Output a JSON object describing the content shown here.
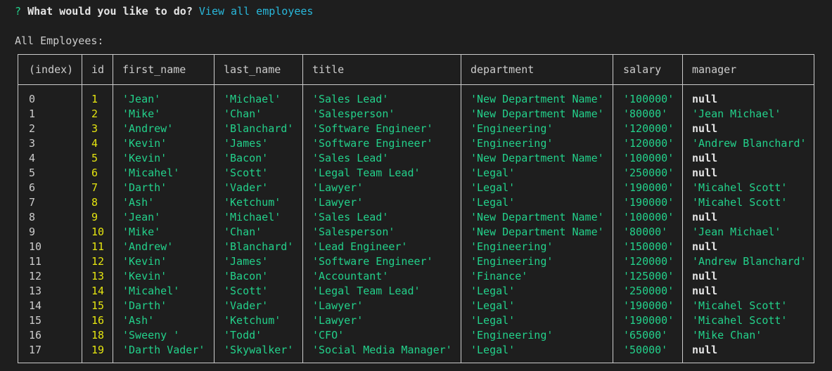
{
  "prompt": {
    "mark": "?",
    "question": "What would you like to do?",
    "answer": "View all employees"
  },
  "table": {
    "caption": "All Employees:",
    "columns": [
      "(index)",
      "id",
      "first_name",
      "last_name",
      "title",
      "department",
      "salary",
      "manager"
    ],
    "rows": [
      [
        "0",
        "1",
        "'Jean'",
        "'Michael'",
        "'Sales Lead'",
        "'New Department Name'",
        "'100000'",
        "null"
      ],
      [
        "1",
        "2",
        "'Mike'",
        "'Chan'",
        "'Salesperson'",
        "'New Department Name'",
        "'80000'",
        "'Jean Michael'"
      ],
      [
        "2",
        "3",
        "'Andrew'",
        "'Blanchard'",
        "'Software Engineer'",
        "'Engineering'",
        "'120000'",
        "null"
      ],
      [
        "3",
        "4",
        "'Kevin'",
        "'James'",
        "'Software Engineer'",
        "'Engineering'",
        "'120000'",
        "'Andrew Blanchard'"
      ],
      [
        "4",
        "5",
        "'Kevin'",
        "'Bacon'",
        "'Sales Lead'",
        "'New Department Name'",
        "'100000'",
        "null"
      ],
      [
        "5",
        "6",
        "'Micahel'",
        "'Scott'",
        "'Legal Team Lead'",
        "'Legal'",
        "'250000'",
        "null"
      ],
      [
        "6",
        "7",
        "'Darth'",
        "'Vader'",
        "'Lawyer'",
        "'Legal'",
        "'190000'",
        "'Micahel Scott'"
      ],
      [
        "7",
        "8",
        "'Ash'",
        "'Ketchum'",
        "'Lawyer'",
        "'Legal'",
        "'190000'",
        "'Micahel Scott'"
      ],
      [
        "8",
        "9",
        "'Jean'",
        "'Michael'",
        "'Sales Lead'",
        "'New Department Name'",
        "'100000'",
        "null"
      ],
      [
        "9",
        "10",
        "'Mike'",
        "'Chan'",
        "'Salesperson'",
        "'New Department Name'",
        "'80000'",
        "'Jean Michael'"
      ],
      [
        "10",
        "11",
        "'Andrew'",
        "'Blanchard'",
        "'Lead Engineer'",
        "'Engineering'",
        "'150000'",
        "null"
      ],
      [
        "11",
        "12",
        "'Kevin'",
        "'James'",
        "'Software Engineer'",
        "'Engineering'",
        "'120000'",
        "'Andrew Blanchard'"
      ],
      [
        "12",
        "13",
        "'Kevin'",
        "'Bacon'",
        "'Accountant'",
        "'Finance'",
        "'125000'",
        "null"
      ],
      [
        "13",
        "14",
        "'Micahel'",
        "'Scott'",
        "'Legal Team Lead'",
        "'Legal'",
        "'250000'",
        "null"
      ],
      [
        "14",
        "15",
        "'Darth'",
        "'Vader'",
        "'Lawyer'",
        "'Legal'",
        "'190000'",
        "'Micahel Scott'"
      ],
      [
        "15",
        "16",
        "'Ash'",
        "'Ketchum'",
        "'Lawyer'",
        "'Legal'",
        "'190000'",
        "'Micahel Scott'"
      ],
      [
        "16",
        "18",
        "'Sweeny '",
        "'Todd'",
        "'CFO'",
        "'Engineering'",
        "'65000'",
        "'Mike Chan'"
      ],
      [
        "17",
        "19",
        "'Darth Vader'",
        "'Skywalker'",
        "'Social Media Manager'",
        "'Legal'",
        "'50000'",
        "null"
      ]
    ]
  }
}
